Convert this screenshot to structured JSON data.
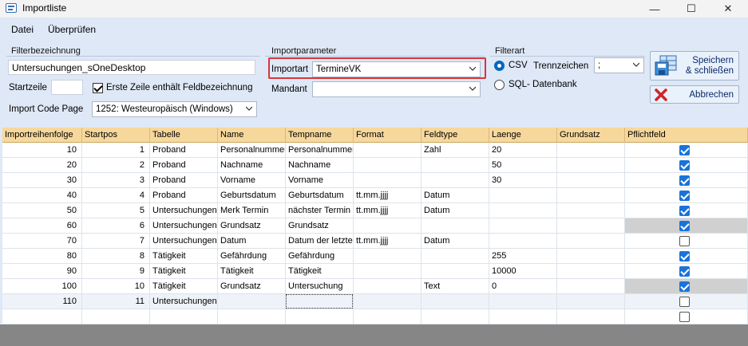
{
  "window": {
    "title": "Importliste",
    "minimize": "—",
    "maximize": "☐",
    "close": "✕"
  },
  "menu": {
    "items": [
      "Datei",
      "Überprüfen"
    ]
  },
  "filter": {
    "group_label": "Filterbezeichnung",
    "name_value": "Untersuchungen_sOneDesktop",
    "startzeile_label": "Startzeile",
    "startzeile_value": "",
    "erste_zeile_label": "Erste Zeile enthält Feldbezeichnung",
    "erste_zeile_checked": true,
    "codepage_label": "Import Code Page",
    "codepage_value": "1252: Westeuropäisch (Windows)"
  },
  "import": {
    "group_label": "Importparameter",
    "importart_label": "Importart",
    "importart_value": "TermineVK",
    "mandant_label": "Mandant",
    "mandant_value": ""
  },
  "filterart": {
    "group_label": "Filterart",
    "csv_label": "CSV",
    "sql_label": "SQL- Datenbank",
    "selected": "CSV",
    "trennzeichen_label": "Trennzeichen",
    "trennzeichen_value": ";"
  },
  "buttons": {
    "save_line1": "Speichern",
    "save_line2": "& schließen",
    "cancel": "Abbrechen"
  },
  "grid": {
    "columns": [
      "Importreihenfolge",
      "Startpos",
      "Tabelle",
      "Name",
      "Tempname",
      "Format",
      "Feldtype",
      "Laenge",
      "Grundsatz",
      "Pflichtfeld"
    ],
    "rows": [
      {
        "importreihenfolge": "10",
        "startpos": "1",
        "tabelle": "Proband",
        "name": "Personalnummer",
        "tempname": "Personalnummer",
        "format": "",
        "feldtype": "Zahl",
        "laenge": "20",
        "grundsatz": "",
        "pflichtfeld": true,
        "gray": false
      },
      {
        "importreihenfolge": "20",
        "startpos": "2",
        "tabelle": "Proband",
        "name": "Nachname",
        "tempname": "Nachname",
        "format": "",
        "feldtype": "",
        "laenge": "50",
        "grundsatz": "",
        "pflichtfeld": true,
        "gray": false
      },
      {
        "importreihenfolge": "30",
        "startpos": "3",
        "tabelle": "Proband",
        "name": "Vorname",
        "tempname": "Vorname",
        "format": "",
        "feldtype": "",
        "laenge": "30",
        "grundsatz": "",
        "pflichtfeld": true,
        "gray": false
      },
      {
        "importreihenfolge": "40",
        "startpos": "4",
        "tabelle": "Proband",
        "name": "Geburtsdatum",
        "tempname": "Geburtsdatum",
        "format": "tt.mm.jjjj",
        "feldtype": "Datum",
        "laenge": "",
        "grundsatz": "",
        "pflichtfeld": true,
        "gray": false
      },
      {
        "importreihenfolge": "50",
        "startpos": "5",
        "tabelle": "Untersuchungen",
        "name": "Merk Termin",
        "tempname": "nächster Termin",
        "format": "tt.mm.jjjj",
        "feldtype": "Datum",
        "laenge": "",
        "grundsatz": "",
        "pflichtfeld": true,
        "gray": false
      },
      {
        "importreihenfolge": "60",
        "startpos": "6",
        "tabelle": "Untersuchungen",
        "name": "Grundsatz",
        "tempname": "Grundsatz",
        "format": "",
        "feldtype": "",
        "laenge": "",
        "grundsatz": "",
        "pflichtfeld": true,
        "gray": true
      },
      {
        "importreihenfolge": "70",
        "startpos": "7",
        "tabelle": "Untersuchungen",
        "name": "Datum",
        "tempname": "Datum der letzten",
        "format": "tt.mm.jjjj",
        "feldtype": "Datum",
        "laenge": "",
        "grundsatz": "",
        "pflichtfeld": false,
        "gray": false
      },
      {
        "importreihenfolge": "80",
        "startpos": "8",
        "tabelle": "Tätigkeit",
        "name": "Gefährdung",
        "tempname": "Gefährdung",
        "format": "",
        "feldtype": "",
        "laenge": "255",
        "grundsatz": "",
        "pflichtfeld": true,
        "gray": false
      },
      {
        "importreihenfolge": "90",
        "startpos": "9",
        "tabelle": "Tätigkeit",
        "name": "Tätigkeit",
        "tempname": "Tätigkeit",
        "format": "",
        "feldtype": "",
        "laenge": "10000",
        "grundsatz": "",
        "pflichtfeld": true,
        "gray": false
      },
      {
        "importreihenfolge": "100",
        "startpos": "10",
        "tabelle": "Tätigkeit",
        "name": "Grundsatz",
        "tempname": "Untersuchung",
        "format": "",
        "feldtype": "Text",
        "laenge": "0",
        "grundsatz": "",
        "pflichtfeld": true,
        "gray": true
      },
      {
        "importreihenfolge": "110",
        "startpos": "11",
        "tabelle": "Untersuchungen",
        "name": "",
        "tempname": "",
        "format": "",
        "feldtype": "",
        "laenge": "",
        "grundsatz": "",
        "pflichtfeld": false,
        "gray": false
      },
      {
        "importreihenfolge": "",
        "startpos": "",
        "tabelle": "",
        "name": "",
        "tempname": "",
        "format": "",
        "feldtype": "",
        "laenge": "",
        "grundsatz": "",
        "pflichtfeld": false,
        "gray": false
      }
    ]
  }
}
